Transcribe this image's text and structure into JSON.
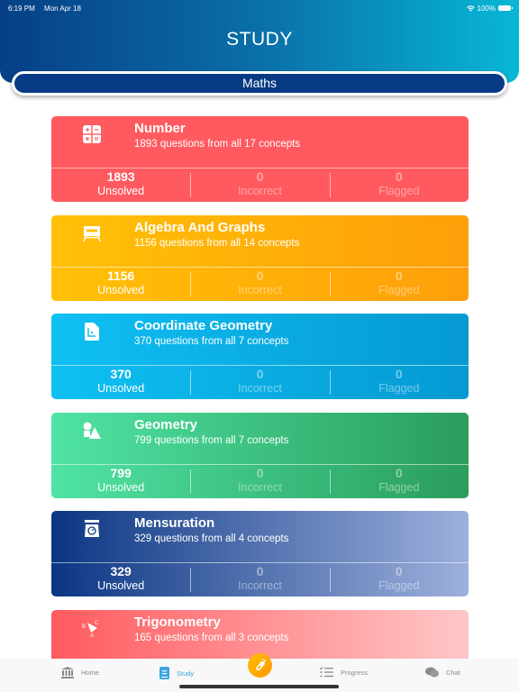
{
  "status_bar": {
    "time": "6:19 PM",
    "date": "Mon Apr 18",
    "battery": "100%"
  },
  "header": {
    "title": "STUDY"
  },
  "subject": {
    "label": "Maths"
  },
  "cards": [
    {
      "icon": "calculator-icon",
      "title": "Number",
      "subtitle": "1893 questions from all 17 concepts",
      "stats": [
        {
          "value": "1893",
          "label": "Unsolved"
        },
        {
          "value": "0",
          "label": "Incorrect"
        },
        {
          "value": "0",
          "label": "Flagged"
        }
      ],
      "colors": [
        "#ff5a5f",
        "#ff5a5f"
      ]
    },
    {
      "icon": "whiteboard-icon",
      "title": "Algebra And Graphs",
      "subtitle": "1156 questions from all 14 concepts",
      "stats": [
        {
          "value": "1156",
          "label": "Unsolved"
        },
        {
          "value": "0",
          "label": "Incorrect"
        },
        {
          "value": "0",
          "label": "Flagged"
        }
      ],
      "colors": [
        "#ffc107",
        "#ff9f0a"
      ]
    },
    {
      "icon": "coordinate-document-icon",
      "title": "Coordinate Geometry",
      "subtitle": "370 questions from all 7 concepts",
      "stats": [
        {
          "value": "370",
          "label": "Unsolved"
        },
        {
          "value": "0",
          "label": "Incorrect"
        },
        {
          "value": "0",
          "label": "Flagged"
        }
      ],
      "colors": [
        "#0fc0f3",
        "#0599d2"
      ]
    },
    {
      "icon": "shapes-icon",
      "title": "Geometry",
      "subtitle": "799 questions from all 7 concepts",
      "stats": [
        {
          "value": "799",
          "label": "Unsolved"
        },
        {
          "value": "0",
          "label": "Incorrect"
        },
        {
          "value": "0",
          "label": "Flagged"
        }
      ],
      "colors": [
        "#50e3a4",
        "#2a9d5c"
      ]
    },
    {
      "icon": "weighing-scale-icon",
      "title": "Mensuration",
      "subtitle": "329 questions from all 4 concepts",
      "stats": [
        {
          "value": "329",
          "label": "Unsolved"
        },
        {
          "value": "0",
          "label": "Incorrect"
        },
        {
          "value": "0",
          "label": "Flagged"
        }
      ],
      "colors": [
        "#0b3683",
        "#9db0dc"
      ]
    },
    {
      "icon": "triangle-abc-icon",
      "title": "Trigonometry",
      "subtitle": "165 questions from all 3 concepts",
      "stats": [],
      "colors": [
        "#ff5a5f",
        "#ffc7c8"
      ]
    }
  ],
  "tabbar": {
    "items": [
      {
        "label": "Home",
        "icon": "bank-icon"
      },
      {
        "label": "Study",
        "icon": "book-icon",
        "active": true
      },
      {
        "label": "Progress",
        "icon": "checklist-icon"
      },
      {
        "label": "Chat",
        "icon": "chat-bubbles-icon"
      }
    ],
    "center_icon": "test-tube-icon"
  }
}
